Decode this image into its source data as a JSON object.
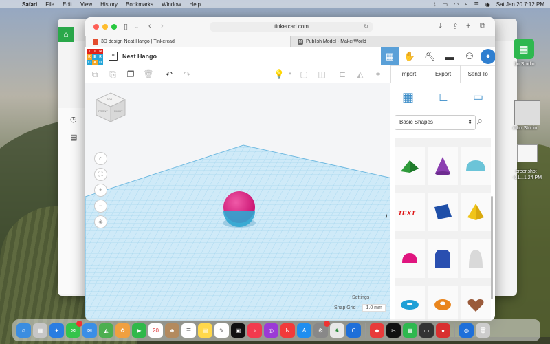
{
  "menubar": {
    "app": "Safari",
    "items": [
      "File",
      "Edit",
      "View",
      "History",
      "Bookmarks",
      "Window",
      "Help"
    ],
    "datetime": "Sat Jan 20  7:12 PM"
  },
  "desktop": {
    "bambu_label": "bu Studio",
    "screenshot_label": "creenshot",
    "screenshot_sub": "-01...1.24 PM",
    "bambu_label2": "mbu Studio"
  },
  "safari": {
    "url": "tinkercad.com",
    "tabs": [
      {
        "label": "3D design Neat Hango | Tinkercad",
        "active": true
      },
      {
        "label": "Publish Model - MakerWorld",
        "active": false
      }
    ]
  },
  "tinkercad": {
    "logo_letters": [
      "T",
      "I",
      "N",
      "K",
      "E",
      "R",
      "C",
      "A",
      "D"
    ],
    "logo_colors": [
      "#e2231a",
      "#e2231a",
      "#e2231a",
      "#f5a623",
      "#25a6d9",
      "#25a6d9",
      "#25a6d9",
      "#f5a623",
      "#25a6d9"
    ],
    "design_name": "Neat Hango",
    "header_icons": [
      "grid-view-icon",
      "paw-icon",
      "pickaxe-icon",
      "brick-icon",
      "add-user-icon",
      "avatar-icon"
    ],
    "buttons": [
      "Import",
      "Export",
      "Send To"
    ],
    "shape_dropdown": "Basic Shapes",
    "settings_label": "Settings",
    "snap_grid_label": "Snap Grid",
    "snap_grid_value": "1.0 mm",
    "viewcube": {
      "top": "TOP",
      "front": "FRONT",
      "right": "RIGHT"
    }
  },
  "colors": {
    "accent_blue": "#5aa0d8",
    "sphere_pink": "#e0157f",
    "sphere_blue": "#2fa6d0",
    "workplane": "#bfe3f5"
  }
}
